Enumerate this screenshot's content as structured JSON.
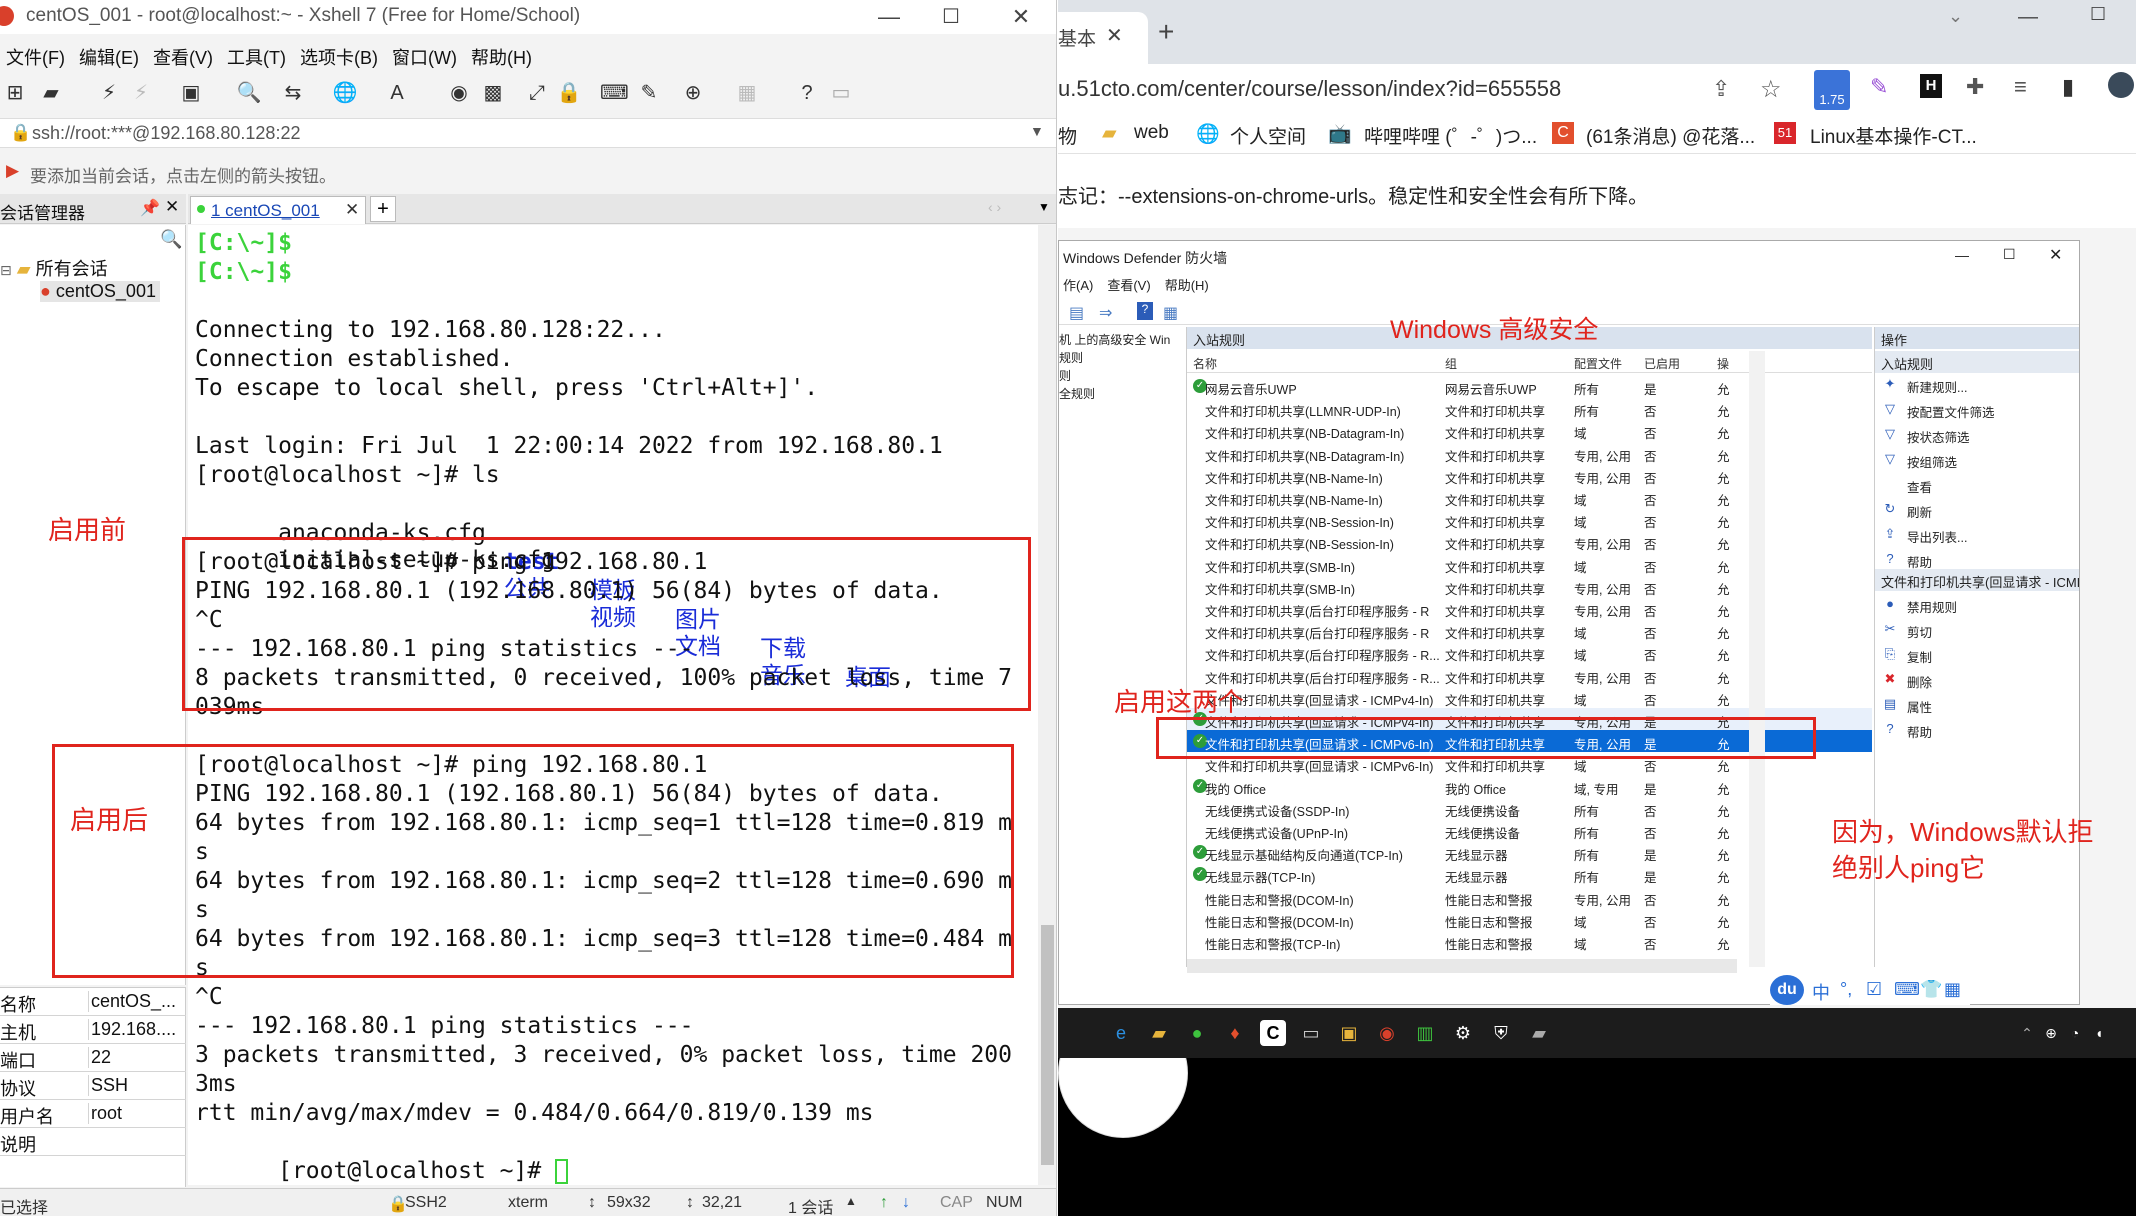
{
  "xshell": {
    "title": "centOS_001 - root@localhost:~ - Xshell 7 (Free for Home/School)",
    "window_buttons": {
      "minimize": "—",
      "maximize": "☐",
      "close": "✕"
    },
    "menu": [
      "文件(F)",
      "编辑(E)",
      "查看(V)",
      "工具(T)",
      "选项卡(B)",
      "窗口(W)",
      "帮助(H)"
    ],
    "address": "ssh://root:***@192.168.80.128:22",
    "hint": "要添加当前会话，点击左侧的箭头按钮。",
    "session_manager_label": "会话管理器",
    "tab_label": "1 centOS_001",
    "tree": {
      "root": "所有会话",
      "child": "centOS_001"
    },
    "props": [
      {
        "k": "名称",
        "v": "centOS_..."
      },
      {
        "k": "主机",
        "v": "192.168...."
      },
      {
        "k": "端口",
        "v": "22"
      },
      {
        "k": "协议",
        "v": "SSH"
      },
      {
        "k": "用户名",
        "v": "root"
      },
      {
        "k": "说明",
        "v": ""
      }
    ],
    "terminal": {
      "prompt1": "[C:\\~]$",
      "prompt2": "[C:\\~]$",
      "l3": "Connecting to 192.168.80.128:22...",
      "l4": "Connection established.",
      "l5": "To escape to local shell, press 'Ctrl+Alt+]'.",
      "l6": "Last login: Fri Jul  1 22:00:14 2022 from 192.168.80.1",
      "l7": "[root@localhost ~]# ls",
      "ls_row1": {
        "f1": "anaconda-ks.cfg",
        "d1": "test",
        "d2": "模板",
        "d3": "图片",
        "d4": "下载",
        "d5": "桌面"
      },
      "ls_row2": {
        "f1": "initial-setup-ks.cfg",
        "d1": "公共",
        "d2": "视频",
        "d3": "文档",
        "d4": "音乐"
      },
      "p1": "[root@localhost ~]# ping 192.168.80.1",
      "p2": "PING 192.168.80.1 (192.168.80.1) 56(84) bytes of data.",
      "p3": "^C",
      "p4": "--- 192.168.80.1 ping statistics ---",
      "p5": "8 packets transmitted, 0 received, 100% packet loss, time 7",
      "p6": "039ms",
      "q1": "[root@localhost ~]# ping 192.168.80.1",
      "q2": "PING 192.168.80.1 (192.168.80.1) 56(84) bytes of data.",
      "q3": "64 bytes from 192.168.80.1: icmp_seq=1 ttl=128 time=0.819 m",
      "q4": "s",
      "q5": "64 bytes from 192.168.80.1: icmp_seq=2 ttl=128 time=0.690 m",
      "q6": "s",
      "q7": "64 bytes from 192.168.80.1: icmp_seq=3 ttl=128 time=0.484 m",
      "q8": "s",
      "q9": "^C",
      "q10": "--- 192.168.80.1 ping statistics ---",
      "q11": "3 packets transmitted, 3 received, 0% packet loss, time 200",
      "q12": "3ms",
      "q13": "rtt min/avg/max/mdev = 0.484/0.664/0.819/0.139 ms",
      "q14": "[root@localhost ~]# "
    },
    "status": {
      "left": "已选择",
      "ssh": "SSH2",
      "term": "xterm",
      "size": "59x32",
      "pos": "32,21",
      "sessions": "1 会话",
      "cap": "CAP",
      "num": "NUM"
    }
  },
  "browser": {
    "tab_label": "基本",
    "url": "u.51cto.com/center/course/lesson/index?id=655558",
    "badge": "1.75",
    "bookmarks": [
      "物",
      "web",
      "个人空间",
      "哔哩哔哩 (゜-゜)つ...",
      "(61条消息) @花落...",
      "Linux基本操作-CT..."
    ],
    "infobar": "志记：--extensions-on-chrome-urls。稳定性和安全性会有所下降。"
  },
  "defender": {
    "title": "Windows Defender 防火墙",
    "menu": [
      "作(A)",
      "查看(V)",
      "帮助(H)"
    ],
    "tree": [
      "机 上的高级安全 Win",
      "规则",
      "则",
      "全规则"
    ],
    "list_header": "入站规则",
    "columns": {
      "name": "名称",
      "group": "组",
      "profile": "配置文件",
      "enabled": "已启用",
      "action": "操"
    },
    "rows": [
      {
        "check": true,
        "name": "网易云音乐UWP",
        "group": "网易云音乐UWP",
        "profile": "所有",
        "enabled": "是",
        "action": "允"
      },
      {
        "check": false,
        "name": "文件和打印机共享(LLMNR-UDP-In)",
        "group": "文件和打印机共享",
        "profile": "所有",
        "enabled": "否",
        "action": "允"
      },
      {
        "check": false,
        "name": "文件和打印机共享(NB-Datagram-In)",
        "group": "文件和打印机共享",
        "profile": "域",
        "enabled": "否",
        "action": "允"
      },
      {
        "check": false,
        "name": "文件和打印机共享(NB-Datagram-In)",
        "group": "文件和打印机共享",
        "profile": "专用, 公用",
        "enabled": "否",
        "action": "允"
      },
      {
        "check": false,
        "name": "文件和打印机共享(NB-Name-In)",
        "group": "文件和打印机共享",
        "profile": "专用, 公用",
        "enabled": "否",
        "action": "允"
      },
      {
        "check": false,
        "name": "文件和打印机共享(NB-Name-In)",
        "group": "文件和打印机共享",
        "profile": "域",
        "enabled": "否",
        "action": "允"
      },
      {
        "check": false,
        "name": "文件和打印机共享(NB-Session-In)",
        "group": "文件和打印机共享",
        "profile": "域",
        "enabled": "否",
        "action": "允"
      },
      {
        "check": false,
        "name": "文件和打印机共享(NB-Session-In)",
        "group": "文件和打印机共享",
        "profile": "专用, 公用",
        "enabled": "否",
        "action": "允"
      },
      {
        "check": false,
        "name": "文件和打印机共享(SMB-In)",
        "group": "文件和打印机共享",
        "profile": "域",
        "enabled": "否",
        "action": "允"
      },
      {
        "check": false,
        "name": "文件和打印机共享(SMB-In)",
        "group": "文件和打印机共享",
        "profile": "专用, 公用",
        "enabled": "否",
        "action": "允"
      },
      {
        "check": false,
        "name": "文件和打印机共享(后台打印程序服务 - R",
        "group": "文件和打印机共享",
        "profile": "专用, 公用",
        "enabled": "否",
        "action": "允"
      },
      {
        "check": false,
        "name": "文件和打印机共享(后台打印程序服务 - R",
        "group": "文件和打印机共享",
        "profile": "域",
        "enabled": "否",
        "action": "允"
      },
      {
        "check": false,
        "name": "文件和打印机共享(后台打印程序服务 - R...",
        "group": "文件和打印机共享",
        "profile": "域",
        "enabled": "否",
        "action": "允"
      },
      {
        "check": false,
        "name": "文件和打印机共享(后台打印程序服务 - R...",
        "group": "文件和打印机共享",
        "profile": "专用, 公用",
        "enabled": "否",
        "action": "允"
      },
      {
        "check": false,
        "name": "文件和打印机共享(回显请求 - ICMPv4-In)",
        "group": "文件和打印机共享",
        "profile": "域",
        "enabled": "否",
        "action": "允"
      },
      {
        "check": true,
        "name": "文件和打印机共享(回显请求 - ICMPv4-In)",
        "group": "文件和打印机共享",
        "profile": "专用, 公用",
        "enabled": "是",
        "action": "允"
      },
      {
        "check": true,
        "name": "文件和打印机共享(回显请求 - ICMPv6-In)",
        "group": "文件和打印机共享",
        "profile": "专用, 公用",
        "enabled": "是",
        "action": "允"
      },
      {
        "check": false,
        "name": "文件和打印机共享(回显请求 - ICMPv6-In)",
        "group": "文件和打印机共享",
        "profile": "域",
        "enabled": "否",
        "action": "允"
      },
      {
        "check": true,
        "name": "我的 Office",
        "group": "我的 Office",
        "profile": "域, 专用",
        "enabled": "是",
        "action": "允"
      },
      {
        "check": false,
        "name": "无线便携式设备(SSDP-In)",
        "group": "无线便携设备",
        "profile": "所有",
        "enabled": "否",
        "action": "允"
      },
      {
        "check": false,
        "name": "无线便携式设备(UPnP-In)",
        "group": "无线便携设备",
        "profile": "所有",
        "enabled": "否",
        "action": "允"
      },
      {
        "check": true,
        "name": "无线显示基础结构反向通道(TCP-In)",
        "group": "无线显示器",
        "profile": "所有",
        "enabled": "是",
        "action": "允"
      },
      {
        "check": true,
        "name": "无线显示器(TCP-In)",
        "group": "无线显示器",
        "profile": "所有",
        "enabled": "是",
        "action": "允"
      },
      {
        "check": false,
        "name": "性能日志和警报(DCOM-In)",
        "group": "性能日志和警报",
        "profile": "专用, 公用",
        "enabled": "否",
        "action": "允"
      },
      {
        "check": false,
        "name": "性能日志和警报(DCOM-In)",
        "group": "性能日志和警报",
        "profile": "域",
        "enabled": "否",
        "action": "允"
      },
      {
        "check": false,
        "name": "性能日志和警报(TCP-In)",
        "group": "性能日志和警报",
        "profile": "域",
        "enabled": "否",
        "action": "允"
      }
    ],
    "actions_header": "操作",
    "actions_sub1": "入站规则",
    "actions1": [
      {
        "icon": "✦",
        "label": "新建规则..."
      },
      {
        "icon": "▽",
        "label": "按配置文件筛选"
      },
      {
        "icon": "▽",
        "label": "按状态筛选"
      },
      {
        "icon": "▽",
        "label": "按组筛选"
      },
      {
        "icon": "",
        "label": "查看"
      },
      {
        "icon": "↻",
        "label": "刷新"
      },
      {
        "icon": "⇪",
        "label": "导出列表..."
      },
      {
        "icon": "?",
        "label": "帮助"
      }
    ],
    "actions_sub2": "文件和打印机共享(回显请求 - ICMPv6...",
    "actions2": [
      {
        "icon": "●",
        "label": "禁用规则"
      },
      {
        "icon": "✂",
        "label": "剪切"
      },
      {
        "icon": "⎘",
        "label": "复制"
      },
      {
        "icon": "✖",
        "label": "删除"
      },
      {
        "icon": "▤",
        "label": "属性"
      },
      {
        "icon": "?",
        "label": "帮助"
      }
    ],
    "section_title": "Windows 高级安全"
  },
  "ime": {
    "logo": "du",
    "items": [
      "中",
      "°,",
      "☑",
      "⌨",
      "👕",
      "▦"
    ]
  },
  "annotations": {
    "before": "启用前",
    "after": "启用后",
    "enable_two": "启用这两个",
    "reason": "因为，Windows默认拒\n绝别人ping它"
  },
  "colors": {
    "annotation_red": "#e0241d",
    "terminal_green": "#3bd33b",
    "terminal_blue": "#1a2cd8",
    "selection_blue": "#0a6ad6"
  }
}
